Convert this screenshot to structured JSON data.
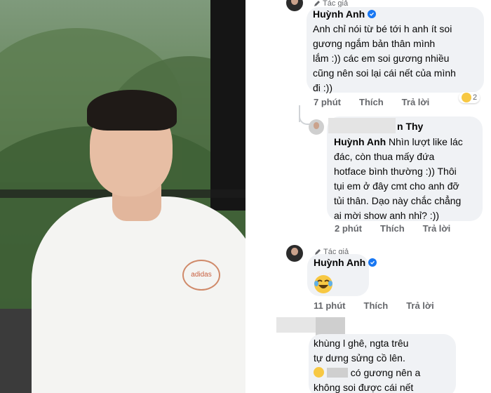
{
  "comments": [
    {
      "author_tag": "Tác giả",
      "name": "Huỳnh Anh",
      "text": "Anh chỉ nói từ bé tới h anh ít soi\ngương ngắm bản thân mình\nlắm :)) các em soi gương nhiều\ncũng nên soi lại cái nết của mình\nđi :))",
      "time": "7 phút",
      "like": "Thích",
      "reply": "Trả lời",
      "reaction_count": "2"
    },
    {
      "name_fragment": "n Thy",
      "mention": "Huỳnh Anh",
      "text_after_mention": " Nhìn lượt like lác",
      "text": "đác, còn thua mấy đứa\nhotface bình thường :)) Thôi\ntụi em ở đây cmt cho anh đỡ\ntủi thân. Dạo này chắc chẳng\nai mời show anh nhỉ? :))",
      "time": "2 phút",
      "like": "Thích",
      "reply": "Trả lời"
    },
    {
      "author_tag": "Tác giả",
      "name": "Huỳnh Anh",
      "time": "11 phút",
      "like": "Thích",
      "reply": "Trả lời"
    },
    {
      "text": "khùng l ghê, ngta trêu\ntự dưng sửng cồ lên.",
      "text_line3": "có gương nên a",
      "text_line4": "không soi được cái nết"
    }
  ],
  "photo": {
    "shirt_logo": "adidas"
  }
}
